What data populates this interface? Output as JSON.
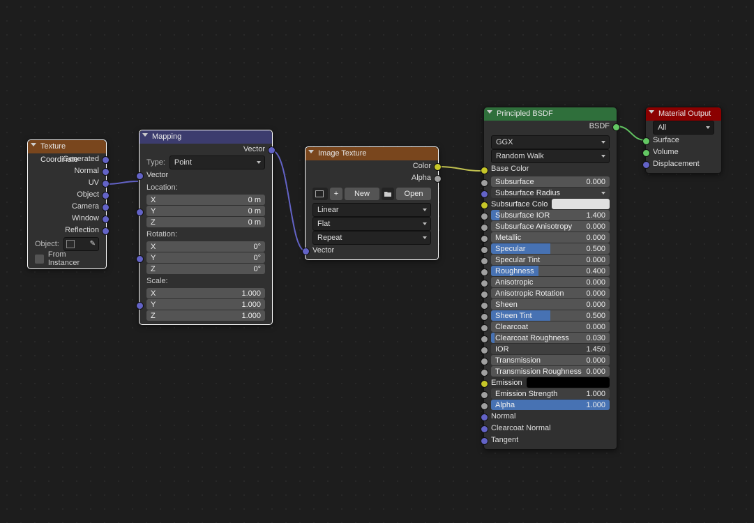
{
  "texcoord": {
    "title": "Texture Coordinate",
    "outs": [
      "Generated",
      "Normal",
      "UV",
      "Object",
      "Camera",
      "Window",
      "Reflection"
    ],
    "object_lbl": "Object:",
    "from_inst": "From Instancer"
  },
  "mapping": {
    "title": "Mapping",
    "vector_out": "Vector",
    "type_lbl": "Type:",
    "type_val": "Point",
    "vector_in": "Vector",
    "loc": "Location:",
    "rot": "Rotation:",
    "scl": "Scale:",
    "loc_x": {
      "l": "X",
      "v": "0 m"
    },
    "loc_y": {
      "l": "Y",
      "v": "0 m"
    },
    "loc_z": {
      "l": "Z",
      "v": "0 m"
    },
    "rot_x": {
      "l": "X",
      "v": "0°"
    },
    "rot_y": {
      "l": "Y",
      "v": "0°"
    },
    "rot_z": {
      "l": "Z",
      "v": "0°"
    },
    "scl_x": {
      "l": "X",
      "v": "1.000"
    },
    "scl_y": {
      "l": "Y",
      "v": "1.000"
    },
    "scl_z": {
      "l": "Z",
      "v": "1.000"
    }
  },
  "imgtex": {
    "title": "Image Texture",
    "color": "Color",
    "alpha": "Alpha",
    "new": "New",
    "open": "Open",
    "interp": "Linear",
    "proj": "Flat",
    "ext": "Repeat",
    "vector": "Vector"
  },
  "bsdf": {
    "title": "Principled BSDF",
    "bsdf_out": "BSDF",
    "dist": "GGX",
    "sss": "Random Walk",
    "base": "Base Color",
    "rows": [
      {
        "name": "Subsurface",
        "val": "0.000",
        "fill": 0
      },
      {
        "name": "Subsurface Radius",
        "dd": true
      },
      {
        "name": "Subsurface Colo",
        "swatch": "#e0e0e0"
      },
      {
        "name": "Subsurface IOR",
        "val": "1.400",
        "fill": 7
      },
      {
        "name": "Subsurface Anisotropy",
        "val": "0.000",
        "fill": 0
      },
      {
        "name": "Metallic",
        "val": "0.000",
        "fill": 0
      },
      {
        "name": "Specular",
        "val": "0.500",
        "fill": 50
      },
      {
        "name": "Specular Tint",
        "val": "0.000",
        "fill": 0
      },
      {
        "name": "Roughness",
        "val": "0.400",
        "fill": 40
      },
      {
        "name": "Anisotropic",
        "val": "0.000",
        "fill": 0
      },
      {
        "name": "Anisotropic Rotation",
        "val": "0.000",
        "fill": 0
      },
      {
        "name": "Sheen",
        "val": "0.000",
        "fill": 0
      },
      {
        "name": "Sheen Tint",
        "val": "0.500",
        "fill": 50
      },
      {
        "name": "Clearcoat",
        "val": "0.000",
        "fill": 0
      },
      {
        "name": "Clearcoat Roughness",
        "val": "0.030",
        "fill": 3
      },
      {
        "name": "IOR",
        "val": "1.450",
        "fill": 0,
        "dark": true
      },
      {
        "name": "Transmission",
        "val": "0.000",
        "fill": 0
      },
      {
        "name": "Transmission Roughness",
        "val": "0.000",
        "fill": 0
      },
      {
        "name": "Emission",
        "swatch": "#000000"
      },
      {
        "name": "Emission Strength",
        "val": "1.000",
        "fill": 0,
        "dark": true
      },
      {
        "name": "Alpha",
        "val": "1.000",
        "fill": 100
      }
    ],
    "tail": [
      "Normal",
      "Clearcoat Normal",
      "Tangent"
    ]
  },
  "matout": {
    "title": "Material Output",
    "target": "All",
    "ins": [
      "Surface",
      "Volume",
      "Displacement"
    ]
  }
}
